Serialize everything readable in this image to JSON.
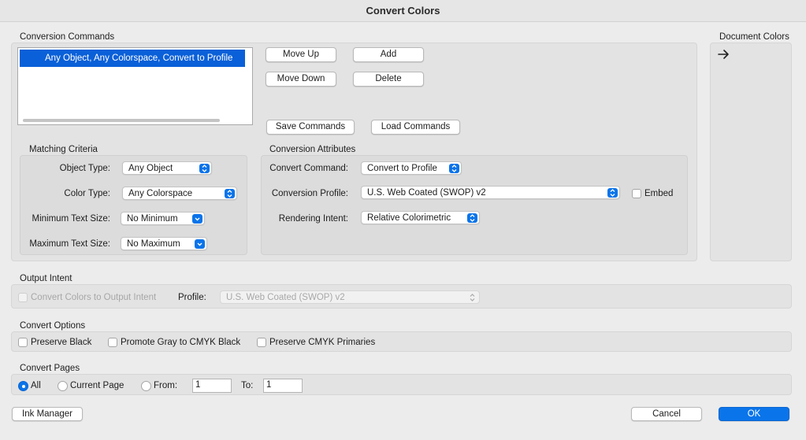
{
  "window": {
    "title": "Convert Colors"
  },
  "conversion_commands": {
    "label": "Conversion Commands",
    "items": [
      "Any Object, Any Colorspace, Convert to Profile"
    ],
    "buttons": {
      "move_up": "Move Up",
      "add": "Add",
      "move_down": "Move Down",
      "delete": "Delete",
      "save_commands": "Save Commands",
      "load_commands": "Load Commands"
    }
  },
  "document_colors": {
    "label": "Document Colors"
  },
  "matching_criteria": {
    "label": "Matching Criteria",
    "object_type": {
      "label": "Object Type:",
      "value": "Any Object"
    },
    "color_type": {
      "label": "Color Type:",
      "value": "Any Colorspace"
    },
    "min_text_size": {
      "label": "Minimum Text Size:",
      "value": "No Minimum"
    },
    "max_text_size": {
      "label": "Maximum Text Size:",
      "value": "No Maximum"
    }
  },
  "conversion_attributes": {
    "label": "Conversion Attributes",
    "convert_command": {
      "label": "Convert Command:",
      "value": "Convert to Profile"
    },
    "conversion_profile": {
      "label": "Conversion Profile:",
      "value": "U.S. Web Coated (SWOP) v2"
    },
    "embed": {
      "label": "Embed",
      "checked": false
    },
    "rendering_intent": {
      "label": "Rendering Intent:",
      "value": "Relative Colorimetric"
    }
  },
  "output_intent": {
    "label": "Output Intent",
    "convert_to_output_intent": {
      "label": "Convert Colors to Output Intent",
      "checked": false,
      "enabled": false
    },
    "profile": {
      "label": "Profile:",
      "value": "U.S. Web Coated (SWOP) v2",
      "enabled": false
    }
  },
  "convert_options": {
    "label": "Convert Options",
    "preserve_black": {
      "label": "Preserve Black",
      "checked": false
    },
    "promote_gray": {
      "label": "Promote Gray to CMYK Black",
      "checked": false
    },
    "preserve_primaries": {
      "label": "Preserve CMYK Primaries",
      "checked": false
    }
  },
  "convert_pages": {
    "label": "Convert Pages",
    "all": {
      "label": "All",
      "selected": true
    },
    "current_page": {
      "label": "Current Page",
      "selected": false
    },
    "from": {
      "label": "From:",
      "value": "1"
    },
    "to": {
      "label": "To:",
      "value": "1"
    }
  },
  "footer": {
    "ink_manager": "Ink Manager",
    "cancel": "Cancel",
    "ok": "OK"
  },
  "colors": {
    "accent": "#0a74ea",
    "selection": "#0a60d8",
    "background": "#ececec"
  }
}
